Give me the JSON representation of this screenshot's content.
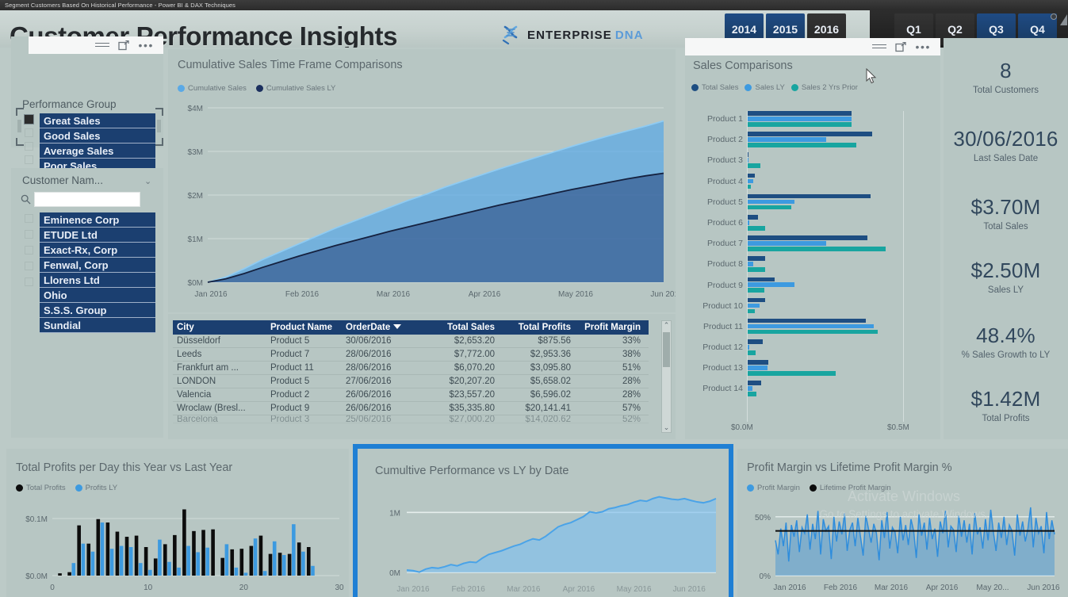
{
  "window": {
    "title": "Segment Customers Based On Historical Performance - Power BI & DAX Techniques"
  },
  "header": {
    "dashboard_title": "Customer Performance Insights",
    "logo_primary": "ENTERPRISE",
    "logo_secondary": "DNA",
    "years": [
      {
        "label": "2014",
        "selected": false
      },
      {
        "label": "2015",
        "selected": false
      },
      {
        "label": "2016",
        "selected": true
      }
    ],
    "quarters": [
      {
        "label": "Q1",
        "selected": true
      },
      {
        "label": "Q2",
        "selected": true
      },
      {
        "label": "Q3",
        "selected": false
      },
      {
        "label": "Q4",
        "selected": false
      }
    ]
  },
  "slicers": {
    "performance_group": {
      "title": "Performance Group",
      "items": [
        "Great Sales",
        "Good Sales",
        "Average Sales",
        "Poor Sales"
      ]
    },
    "customer_name": {
      "title": "Customer Nam...",
      "search_placeholder": "",
      "search_value": "",
      "items": [
        "Eminence Corp",
        "ETUDE Ltd",
        "Exact-Rx, Corp",
        "Fenwal, Corp",
        "Llorens Ltd",
        "Ohio",
        "S.S.S. Group",
        "Sundial"
      ]
    }
  },
  "kpis": [
    {
      "value": "8",
      "label": "Total Customers"
    },
    {
      "value": "30/06/2016",
      "label": "Last Sales Date"
    },
    {
      "value": "$3.70M",
      "label": "Total Sales"
    },
    {
      "value": "$2.50M",
      "label": "Sales LY"
    },
    {
      "value": "48.4%",
      "label": "% Sales Growth to LY"
    },
    {
      "value": "$1.42M",
      "label": "Total Profits"
    }
  ],
  "table": {
    "columns": [
      "City",
      "Product Name",
      "OrderDate",
      "Total Sales",
      "Total Profits",
      "Profit Margin"
    ],
    "sort_column": "OrderDate",
    "sort_direction": "descending",
    "rows": [
      [
        "Düsseldorf",
        "Product 5",
        "30/06/2016",
        "$2,653.20",
        "$875.56",
        "33%"
      ],
      [
        "Leeds",
        "Product 7",
        "28/06/2016",
        "$7,772.00",
        "$2,953.36",
        "38%"
      ],
      [
        "Frankfurt am ...",
        "Product 11",
        "28/06/2016",
        "$6,070.20",
        "$3,095.80",
        "51%"
      ],
      [
        "LONDON",
        "Product 5",
        "27/06/2016",
        "$20,207.20",
        "$5,658.02",
        "28%"
      ],
      [
        "Valencia",
        "Product 2",
        "26/06/2016",
        "$23,557.20",
        "$6,596.02",
        "28%"
      ],
      [
        "Wroclaw (Bresl...",
        "Product 9",
        "26/06/2016",
        "$35,335.80",
        "$20,141.41",
        "57%"
      ],
      [
        "Barcelona",
        "Product 3",
        "25/06/2016",
        "$27,000.20",
        "$14,020.62",
        "52%"
      ]
    ]
  },
  "chart_data": [
    {
      "id": "cumulative_sales_time_frame",
      "type": "area",
      "title": "Cumulative Sales Time Frame Comparisons",
      "legend": [
        {
          "name": "Cumulative Sales",
          "color": "#5aa9e6"
        },
        {
          "name": "Cumulative Sales LY",
          "color": "#1b2f5e"
        }
      ],
      "legend_position": "top",
      "grid": true,
      "xlabel": "",
      "ylabel": "",
      "x_ticks": [
        "Jan 2016",
        "Feb 2016",
        "Mar 2016",
        "Apr 2016",
        "May 2016",
        "Jun 2016"
      ],
      "y_ticks": [
        "$0M",
        "$1M",
        "$2M",
        "$3M",
        "$4M"
      ],
      "ylim": [
        0,
        4000000
      ],
      "series": [
        {
          "name": "Cumulative Sales",
          "color": "#5aa9e6",
          "values": [
            0,
            120000,
            310000,
            520000,
            700000,
            880000,
            1060000,
            1240000,
            1400000,
            1560000,
            1720000,
            1880000,
            2020000,
            2180000,
            2320000,
            2460000,
            2600000,
            2730000,
            2860000,
            2990000,
            3120000,
            3240000,
            3360000,
            3470000,
            3580000,
            3700000
          ]
        },
        {
          "name": "Cumulative Sales LY",
          "color": "#1b2f5e",
          "values": [
            0,
            80000,
            200000,
            340000,
            470000,
            600000,
            720000,
            840000,
            950000,
            1060000,
            1170000,
            1270000,
            1370000,
            1470000,
            1570000,
            1670000,
            1770000,
            1860000,
            1950000,
            2040000,
            2130000,
            2210000,
            2290000,
            2370000,
            2440000,
            2500000
          ]
        }
      ]
    },
    {
      "id": "sales_comparisons",
      "type": "bar",
      "orientation": "horizontal",
      "title": "Sales Comparisons",
      "legend": [
        {
          "name": "Total Sales",
          "color": "#1e4e82"
        },
        {
          "name": "Sales LY",
          "color": "#3d9ae0"
        },
        {
          "name": "Sales 2 Yrs Prior",
          "color": "#18a5a0"
        }
      ],
      "legend_position": "top",
      "categories": [
        "Product 1",
        "Product 2",
        "Product 3",
        "Product 4",
        "Product 5",
        "Product 6",
        "Product 7",
        "Product 8",
        "Product 9",
        "Product 10",
        "Product 11",
        "Product 12",
        "Product 13",
        "Product 14"
      ],
      "x_ticks": [
        "$0.0M",
        "$0.5M"
      ],
      "xlim": [
        0,
        0.55
      ],
      "series": [
        {
          "name": "Total Sales",
          "color": "#1e4e82",
          "values": [
            0.33,
            0.395,
            0.003,
            0.022,
            0.39,
            0.032,
            0.38,
            0.055,
            0.085,
            0.055,
            0.375,
            0.048,
            0.065,
            0.042
          ]
        },
        {
          "name": "Sales LY",
          "color": "#3d9ae0",
          "values": [
            0.33,
            0.25,
            0.0,
            0.018,
            0.15,
            0.004,
            0.25,
            0.018,
            0.148,
            0.038,
            0.4,
            0.004,
            0.062,
            0.014
          ]
        },
        {
          "name": "Sales 2 Yrs Prior",
          "color": "#18a5a0",
          "values": [
            0.33,
            0.345,
            0.04,
            0.011,
            0.14,
            0.055,
            0.44,
            0.055,
            0.052,
            0.022,
            0.415,
            0.026,
            0.28,
            0.028
          ]
        }
      ]
    },
    {
      "id": "total_profits_per_day",
      "type": "bar",
      "orientation": "vertical",
      "title": "Total Profits per Day this Year vs Last Year",
      "legend": [
        {
          "name": "Total Profits",
          "color": "#0c0c0c"
        },
        {
          "name": "Profits LY",
          "color": "#3d9ae0"
        }
      ],
      "legend_position": "top",
      "x_ticks": [
        "0",
        "10",
        "20",
        "30"
      ],
      "y_ticks": [
        "$0.0M",
        "$0.1M"
      ],
      "ylim": [
        0,
        0.125
      ],
      "categories": [
        1,
        2,
        3,
        4,
        5,
        6,
        7,
        8,
        9,
        10,
        11,
        12,
        13,
        14,
        15,
        16,
        17,
        18,
        19,
        20,
        21,
        22,
        23,
        24,
        25,
        26,
        27
      ],
      "series": [
        {
          "name": "Total Profits",
          "color": "#0c0c0c",
          "values": [
            0.004,
            0.006,
            0.088,
            0.056,
            0.099,
            0.093,
            0.077,
            0.068,
            0.07,
            0.05,
            0.03,
            0.055,
            0.071,
            0.116,
            0.078,
            0.08,
            0.081,
            0.031,
            0.046,
            0.047,
            0.052,
            0.07,
            0.038,
            0.04,
            0.038,
            0.058,
            0.05
          ]
        },
        {
          "name": "Profits LY",
          "color": "#3d9ae0",
          "values": [
            0.0,
            0.022,
            0.056,
            0.042,
            0.093,
            0.047,
            0.052,
            0.05,
            0.022,
            0.01,
            0.063,
            0.024,
            0.014,
            0.052,
            0.041,
            0.049,
            0.0,
            0.055,
            0.014,
            0.005,
            0.065,
            0.008,
            0.06,
            0.036,
            0.09,
            0.042,
            0.017
          ]
        }
      ]
    },
    {
      "id": "cumultive_performance_vs_ly",
      "type": "area",
      "title": "Cumultive Performance vs LY by Date",
      "selected": true,
      "grid": true,
      "x_ticks": [
        "Jan 2016",
        "Feb 2016",
        "Mar 2016",
        "Apr 2016",
        "May 2016",
        "Jun 2016"
      ],
      "y_ticks": [
        "0M",
        "1M"
      ],
      "ylim": [
        0,
        1400000
      ],
      "series": [
        {
          "name": "Cumultive Performance vs LY",
          "color": "#5aa9e6",
          "values": [
            40000,
            30000,
            5000,
            55000,
            80000,
            70000,
            95000,
            130000,
            110000,
            150000,
            175000,
            165000,
            240000,
            300000,
            330000,
            360000,
            400000,
            440000,
            470000,
            520000,
            560000,
            540000,
            600000,
            680000,
            760000,
            800000,
            830000,
            880000,
            930000,
            1010000,
            990000,
            1010000,
            1060000,
            1080000,
            1110000,
            1130000,
            1170000,
            1200000,
            1185000,
            1230000,
            1260000,
            1240000,
            1220000,
            1210000,
            1230000,
            1200000,
            1175000,
            1160000,
            1185000,
            1230000
          ]
        }
      ]
    },
    {
      "id": "profit_margin_vs_lifetime",
      "type": "area",
      "title": "Profit Margin vs Lifetime Profit Margin %",
      "legend": [
        {
          "name": "Profit Margin",
          "color": "#3d9ae0"
        },
        {
          "name": "Lifetime Profit Margin",
          "color": "#0c0c0c"
        }
      ],
      "legend_position": "top",
      "x_ticks": [
        "Jan 2016",
        "Feb 2016",
        "Mar 2016",
        "Apr 2016",
        "May 20...",
        "Jun 2016"
      ],
      "y_ticks": [
        "0%",
        "50%"
      ],
      "ylim": [
        0,
        0.62
      ],
      "lifetime_profit_margin": 0.38,
      "series": [
        {
          "name": "Profit Margin",
          "color": "#3d9ae0",
          "values": [
            0.3,
            0.18,
            0.4,
            0.25,
            0.45,
            0.12,
            0.43,
            0.33,
            0.47,
            0.2,
            0.41,
            0.36,
            0.52,
            0.22,
            0.44,
            0.31,
            0.55,
            0.18,
            0.48,
            0.38,
            0.42,
            0.14,
            0.5,
            0.29,
            0.46,
            0.35,
            0.53,
            0.21,
            0.39,
            0.45,
            0.25,
            0.49,
            0.33,
            0.17,
            0.51,
            0.4,
            0.28,
            0.44,
            0.36,
            0.13,
            0.47,
            0.32,
            0.54,
            0.23,
            0.41,
            0.37,
            0.19,
            0.5,
            0.3,
            0.43,
            0.26,
            0.48,
            0.38,
            0.15,
            0.52,
            0.34,
            0.45,
            0.22,
            0.49,
            0.31,
            0.4,
            0.16,
            0.46,
            0.36,
            0.55,
            0.24,
            0.42,
            0.39,
            0.2,
            0.51,
            0.33,
            0.47,
            0.28,
            0.44,
            0.18,
            0.53,
            0.35,
            0.41,
            0.23,
            0.48,
            0.3,
            0.56,
            0.37,
            0.21,
            0.45,
            0.32,
            0.5,
            0.26,
            0.43,
            0.38,
            0.17,
            0.52,
            0.34,
            0.46,
            0.29,
            0.4,
            0.58,
            0.24,
            0.49,
            0.36,
            0.42,
            0.19,
            0.54,
            0.31,
            0.47,
            0.35
          ]
        }
      ]
    }
  ],
  "visual_headers": {
    "hamburger": "filter-icon",
    "focus": "focus-mode-icon",
    "more": "more-options-icon"
  },
  "watermark": {
    "line1": "Activate Windows",
    "line2": "Go to Settings to activate Windows."
  }
}
